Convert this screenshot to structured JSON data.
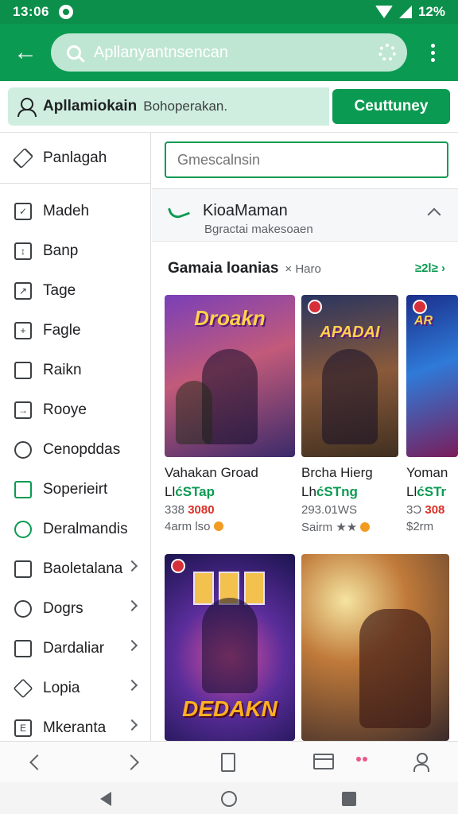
{
  "status_bar": {
    "time": "13:06",
    "battery": "12%"
  },
  "app_bar": {
    "search_text": "Apllanyantnsencan"
  },
  "banner": {
    "title": "Apllamiokain",
    "subtitle": "Bohoperakan.",
    "button": "Ceuttuney"
  },
  "sidebar": {
    "header": "Panlagah",
    "items": [
      {
        "label": "Madeh",
        "icon": "bookmark-icon"
      },
      {
        "label": "Banp",
        "icon": "download-icon"
      },
      {
        "label": "Tage",
        "icon": "tag-icon"
      },
      {
        "label": "Fagle",
        "icon": "file-icon"
      },
      {
        "label": "Raikn",
        "icon": "page-icon"
      },
      {
        "label": "Rooye",
        "icon": "folder-icon"
      },
      {
        "label": "Cenopddas",
        "icon": "clock-icon"
      },
      {
        "label": "Soperieirt",
        "icon": "shield-icon"
      },
      {
        "label": "Deralmandis",
        "icon": "globe-icon"
      },
      {
        "label": "Baoletalana",
        "icon": "briefcase-icon"
      },
      {
        "label": "Dogrs",
        "icon": "search-icon"
      },
      {
        "label": "Dardaliar",
        "icon": "layers-icon"
      },
      {
        "label": "Lopia",
        "icon": "diamond-icon"
      },
      {
        "label": "Mkeranta",
        "icon": "document-icon"
      }
    ]
  },
  "main": {
    "search_placeholder": "Gmescalnsin",
    "section": {
      "title": "KioaMaman",
      "subtitle": "Bgractai makesoaen"
    },
    "games_title": "Gamaia loanias",
    "games_sub": "Haro",
    "see_more": "≥2l≥",
    "cards": [
      {
        "art_title": "Droakn",
        "name": "Vahakan Groad",
        "studio_a": "Ll",
        "studio_b": "ćSTap",
        "price_a": "338",
        "price_b": "3080",
        "meta": "4arm lso"
      },
      {
        "art_title": "APADAI",
        "name": "Brcha Hierg",
        "studio_a": "Lh",
        "studio_b": "ćSTng",
        "price_a": "293.01WS",
        "price_b": "",
        "meta": "Sairm ★★"
      },
      {
        "art_title": "AR",
        "name": "Yoman",
        "studio_a": "Ll",
        "studio_b": "ćSTr",
        "price_a": "3Ɔ",
        "price_b": "308",
        "meta": "$2rm"
      },
      {
        "art_title": "DEDAKN",
        "name": "",
        "studio_a": "",
        "studio_b": "",
        "price_a": "",
        "price_b": "",
        "meta": ""
      },
      {
        "art_title": "",
        "name": "",
        "studio_a": "",
        "studio_b": "",
        "price_a": "",
        "price_b": "",
        "meta": ""
      }
    ]
  },
  "colors": {
    "brand": "#0b9a52",
    "status": "#0b8f4a",
    "price_accent": "#d93025"
  }
}
